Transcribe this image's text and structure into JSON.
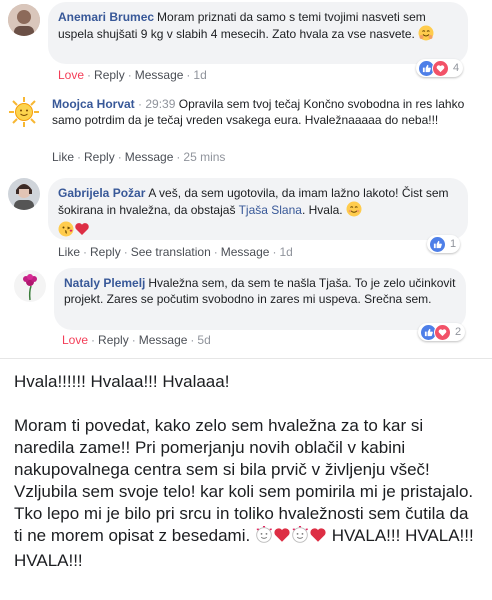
{
  "comments": [
    {
      "author": "Anemari Brumec",
      "time": "",
      "text": "Moram priznati da samo s temi tvojimi nasveti sem uspela shujšati 9 kg v slabih 4 mesecih. Zato hvala za vse nasvete.",
      "emoji": "hugging-face-emoji",
      "actions": {
        "first": "Love",
        "reply": "Reply",
        "message": "Message",
        "ago": "1d"
      },
      "reactions": {
        "icons": [
          "like-icon",
          "heart-icon"
        ],
        "count": "4"
      }
    },
    {
      "author": "Moojca Horvat",
      "time": "29:39",
      "text": "Opravila sem tvoj tečaj Končno svobodna in res lahko samo potrdim da je tečaj vreden vsakega eura. Hvaležnaaaaa do neba!!!",
      "actions": {
        "first": "Like",
        "reply": "Reply",
        "message": "Message",
        "ago": "25 mins"
      }
    },
    {
      "author": "Gabrijela Požar",
      "text_before_tag": "A veš, da sem ugotovila, da imam lažno lakoto! Čist sem šokirana in hvaležna, da obstajaš",
      "tag": "Tjaša Slana",
      "text_after_tag": ". Hvala.",
      "emojis": [
        "smiling-face-emoji",
        "kissing-face-emoji",
        "red-heart-emoji"
      ],
      "actions": {
        "first": "Like",
        "reply": "Reply",
        "translate": "See translation",
        "message": "Message",
        "ago": "1d"
      },
      "reactions": {
        "icons": [
          "like-icon"
        ],
        "count": "1"
      }
    },
    {
      "author": "Nataly Plemelj",
      "text": "Hvaležna sem, da sem te našla Tjaša. To je zelo učinkovit projekt. Zares se počutim svobodno in zares mi uspeva. Srečna sem.",
      "actions": {
        "first": "Love",
        "reply": "Reply",
        "message": "Message",
        "ago": "5d"
      },
      "reactions": {
        "icons": [
          "like-icon",
          "heart-icon"
        ],
        "count": "2"
      }
    }
  ],
  "post": {
    "line1": "Hvala!!!!!! Hvalaa!!! Hvalaaa!",
    "body": "Moram ti povedat, kako zelo sem hvaležna za to kar si naredila zame!! Pri pomerjanju novih oblačil v kabini nakupovalnega centra sem si bila prvič v življenju všeč! Vzljubila sem svoje telo! kar koli sem pomirila mi je pristajalo. Tko lepo mi je bilo pri srcu in  toliko hvaležnosti sem čutila da ti ne morem opisat z besedami.",
    "emojis": [
      "smiling-face-with-hearts-emoji",
      "red-heart-emoji",
      "smiling-face-with-hearts-emoji",
      "red-heart-emoji"
    ],
    "closing": "HVALA!!! HVALA!!! HVALA!!!"
  },
  "colors": {
    "link": "#385898",
    "love": "#f33e58",
    "bubble": "#f2f3f5",
    "like_icon": "#4e7fe8",
    "heart_icon": "#f25268"
  }
}
